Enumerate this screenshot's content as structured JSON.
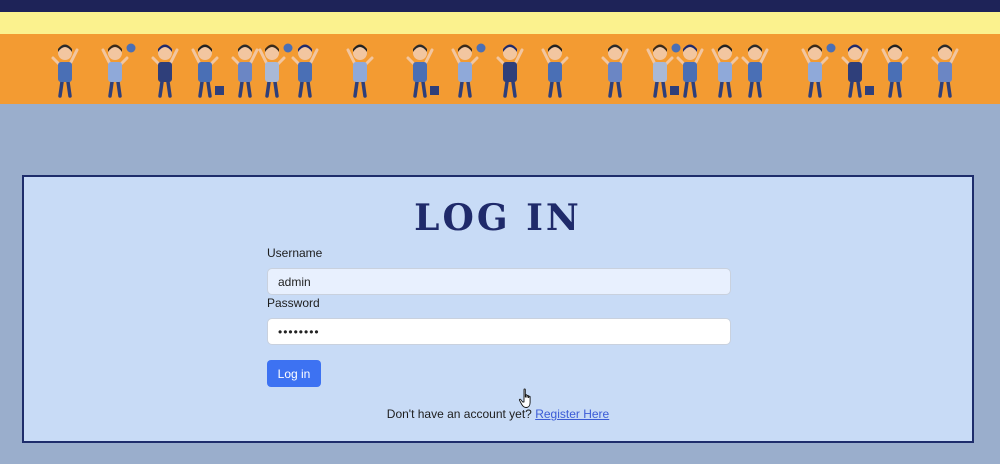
{
  "header": {
    "banner_icon": "children-playing-illustration",
    "colors": {
      "top_bar": "#1e2358",
      "yellow_band": "#fbf28e",
      "orange_band": "#f39b32"
    }
  },
  "login": {
    "title": "LOG IN",
    "username_label": "Username",
    "username_value": "admin",
    "password_label": "Password",
    "password_value": "••••••••",
    "submit_label": "Log in",
    "register_prompt": "Don't have an account yet?",
    "register_link": "Register Here"
  },
  "colors": {
    "page_bg": "#9aaecc",
    "card_bg": "#c8dbf6",
    "card_border": "#1e2d6b",
    "title": "#1f2a6a",
    "button": "#3d72f2",
    "link": "#3b5bd6"
  },
  "cursor": {
    "icon": "hand-pointer-icon"
  }
}
